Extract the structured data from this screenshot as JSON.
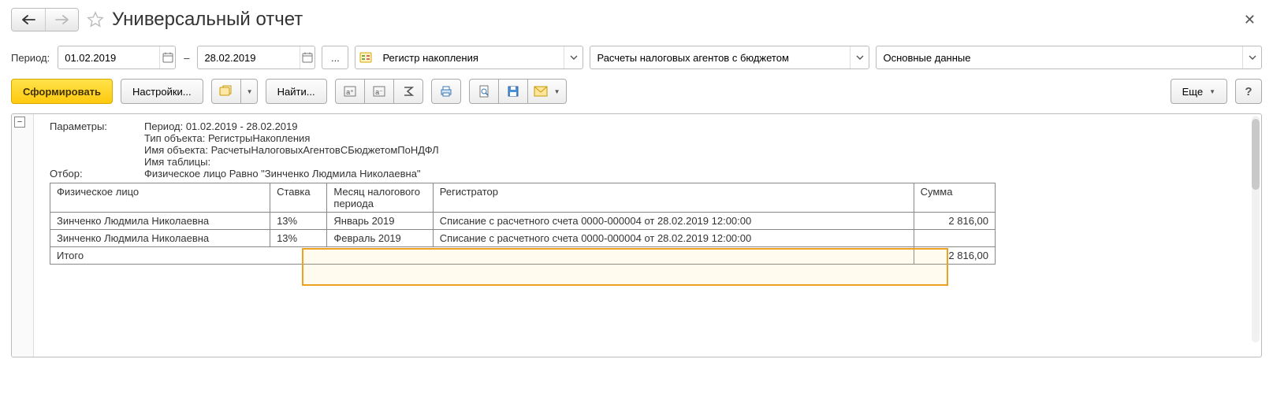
{
  "header": {
    "title": "Универсальный отчет"
  },
  "filters": {
    "period_label": "Период:",
    "date_from": "01.02.2019",
    "date_to": "28.02.2019",
    "dash": "–",
    "ellipsis": "...",
    "register_type": "Регистр накопления",
    "register_name": "Расчеты налоговых агентов с бюджетом",
    "data_name": "Основные данные"
  },
  "toolbar": {
    "run": "Сформировать",
    "settings": "Настройки...",
    "find": "Найти...",
    "more": "Еще",
    "help": "?"
  },
  "tree": {
    "toggle": "−"
  },
  "params": {
    "label": "Параметры:",
    "period_line": "Период: 01.02.2019 - 28.02.2019",
    "type_line": "Тип объекта: РегистрыНакопления",
    "name_line": "Имя объекта: РасчетыНалоговыхАгентовСБюджетомПоНДФЛ",
    "table_line": "Имя таблицы:",
    "filter_label": "Отбор:",
    "filter_line": "Физическое лицо Равно \"Зинченко Людмила Николаевна\""
  },
  "table": {
    "cols": {
      "person": "Физическое лицо",
      "rate": "Ставка",
      "month": "Месяц налогового периода",
      "registrar": "Регистратор",
      "sum": "Сумма"
    },
    "rows": [
      {
        "person": "Зинченко Людмила Николаевна",
        "rate": "13%",
        "month": "Январь 2019",
        "registrar": "Списание с расчетного счета 0000-000004 от 28.02.2019 12:00:00",
        "sum": "2 816,00"
      },
      {
        "person": "Зинченко Людмила Николаевна",
        "rate": "13%",
        "month": "Февраль 2019",
        "registrar": "Списание с расчетного счета 0000-000004 от 28.02.2019 12:00:00",
        "sum": ""
      }
    ],
    "total_label": "Итого",
    "total_sum": "2 816,00"
  }
}
